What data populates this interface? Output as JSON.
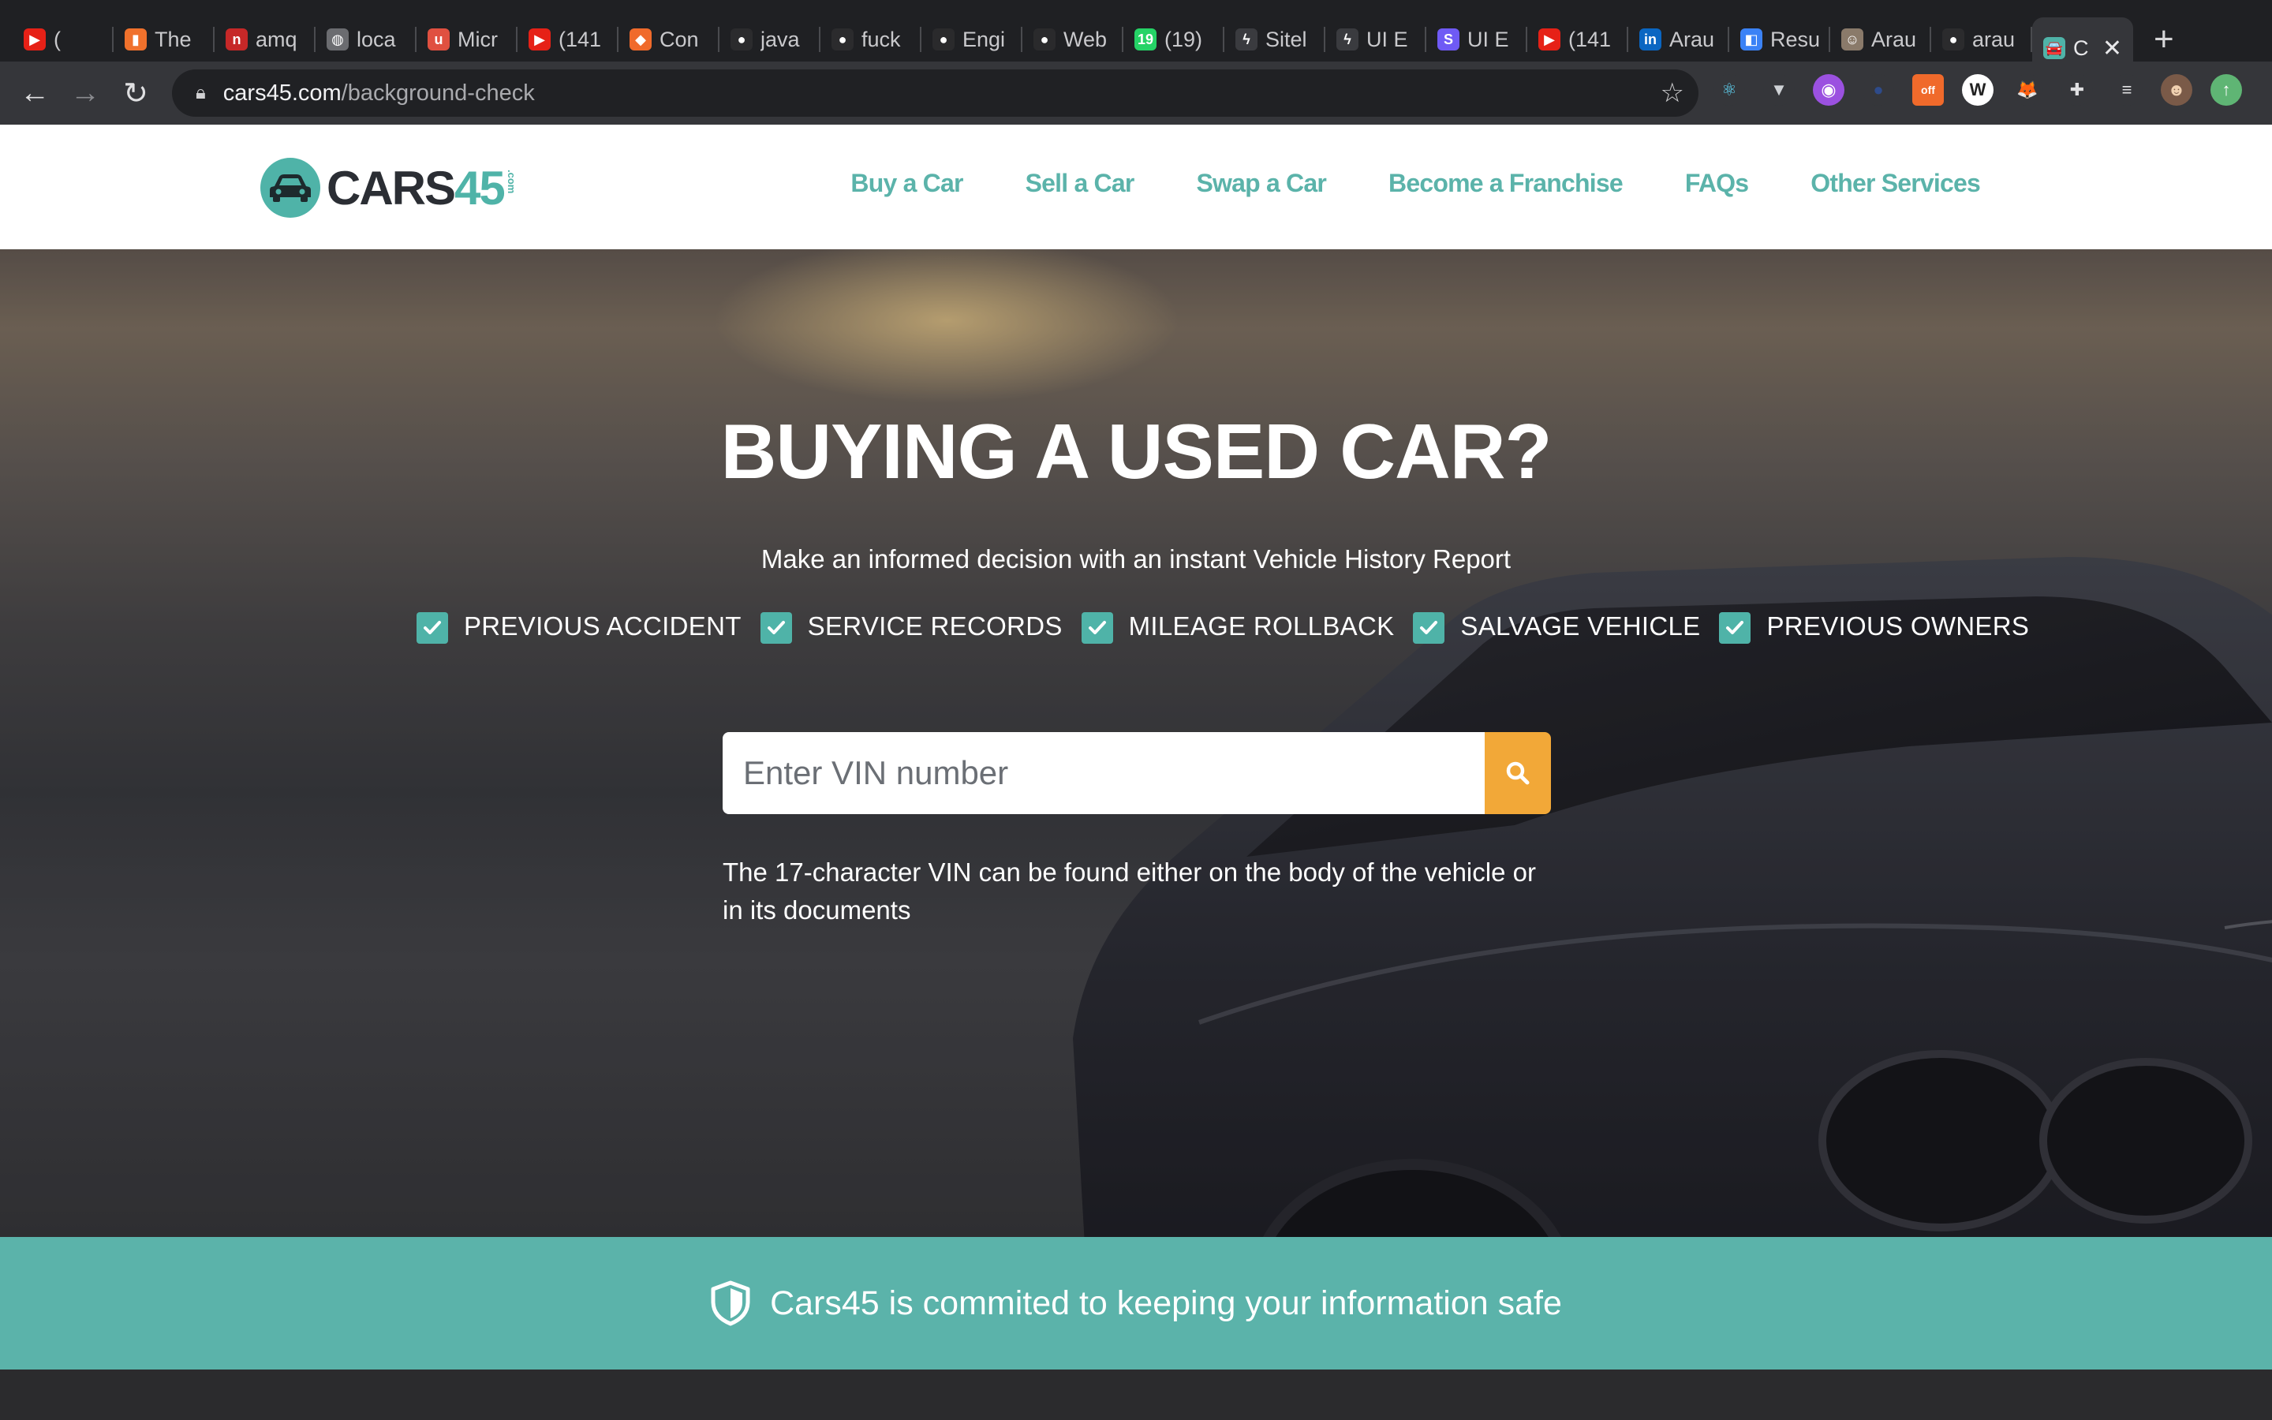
{
  "browser": {
    "tabs": [
      {
        "title": "(",
        "icon": "youtube-icon",
        "color": "#e62117",
        "glyph": "▶"
      },
      {
        "title": "The",
        "icon": "bucket-icon",
        "color": "#f0712c",
        "glyph": "▮"
      },
      {
        "title": "amq",
        "icon": "n-icon",
        "color": "#c62828",
        "glyph": "n"
      },
      {
        "title": "loca",
        "icon": "globe-icon",
        "color": "#6b6c70",
        "glyph": "◍"
      },
      {
        "title": "Micr",
        "icon": "u-icon",
        "color": "#e05040",
        "glyph": "u"
      },
      {
        "title": "(141",
        "icon": "youtube-icon",
        "color": "#e62117",
        "glyph": "▶"
      },
      {
        "title": "Con",
        "icon": "tag-icon",
        "color": "#f06a2b",
        "glyph": "◆"
      },
      {
        "title": "java",
        "icon": "github-icon",
        "color": "#2b2b2d",
        "glyph": "●"
      },
      {
        "title": "fuck",
        "icon": "github-icon",
        "color": "#2b2b2d",
        "glyph": "●"
      },
      {
        "title": "Engi",
        "icon": "dark-circle-icon",
        "color": "#2a2a2c",
        "glyph": "●"
      },
      {
        "title": "Web",
        "icon": "dark-circle-icon",
        "color": "#2a2a2c",
        "glyph": "●"
      },
      {
        "title": "(19)",
        "icon": "whatsapp-icon",
        "color": "#25d366",
        "glyph": "19"
      },
      {
        "title": "Sitel",
        "icon": "bolt-icon",
        "color": "#3a3b3f",
        "glyph": "ϟ"
      },
      {
        "title": "UI E",
        "icon": "bolt-icon",
        "color": "#3a3b3f",
        "glyph": "ϟ"
      },
      {
        "title": "UI E",
        "icon": "s-icon",
        "color": "#6f5af5",
        "glyph": "S"
      },
      {
        "title": "(141",
        "icon": "youtube-icon",
        "color": "#e62117",
        "glyph": "▶"
      },
      {
        "title": "Arau",
        "icon": "linkedin-icon",
        "color": "#0a66c2",
        "glyph": "in"
      },
      {
        "title": "Resu",
        "icon": "squares-icon",
        "color": "#3b82f6",
        "glyph": "◧"
      },
      {
        "title": "Arau",
        "icon": "portrait-icon",
        "color": "#8a7a6a",
        "glyph": "☺"
      },
      {
        "title": "arau",
        "icon": "github-icon",
        "color": "#2b2b2d",
        "glyph": "●"
      }
    ],
    "active_tab": {
      "title": "C",
      "icon": "cars45-favicon-icon",
      "color": "#4fb3a8",
      "glyph": "🚘",
      "close": "✕"
    },
    "new_tab": "+",
    "url_host": "cars45.com",
    "url_path": "/background-check",
    "extensions": [
      {
        "name": "react-devtools-icon",
        "color": "#35363a",
        "glyph": "⚛",
        "fg": "#61dafb"
      },
      {
        "name": "vue-devtools-icon",
        "color": "#35363a",
        "glyph": "▼",
        "fg": "#cfd2d6"
      },
      {
        "name": "purple-ext-icon",
        "color": "#9b51e0",
        "glyph": "◉",
        "fg": "#ffffff"
      },
      {
        "name": "blue-ext-icon",
        "color": "#35363a",
        "glyph": "●",
        "fg": "#2e4b8a"
      },
      {
        "name": "off-badge-ext-icon",
        "color": "#f06a2b",
        "glyph": "off",
        "fg": "#ffffff"
      },
      {
        "name": "w-ext-icon",
        "color": "#ffffff",
        "glyph": "W",
        "fg": "#222222"
      },
      {
        "name": "metamask-icon",
        "color": "#35363a",
        "glyph": "🦊",
        "fg": "#f6851b"
      },
      {
        "name": "puzzle-extensions-icon",
        "color": "#35363a",
        "glyph": "✚",
        "fg": "#e0e0e2"
      },
      {
        "name": "reading-list-icon",
        "color": "#35363a",
        "glyph": "≡",
        "fg": "#e0e0e2"
      },
      {
        "name": "profile-avatar-icon",
        "color": "#7a5a48",
        "glyph": "☻",
        "fg": "#f0d0b0"
      },
      {
        "name": "update-arrow-icon",
        "color": "#5fb574",
        "glyph": "↑",
        "fg": "#ffffff"
      }
    ]
  },
  "site": {
    "logo_word": "CARS",
    "logo_num": "45",
    "logo_com": ".com",
    "nav": [
      "Buy a Car",
      "Sell a Car",
      "Swap a Car",
      "Become a Franchise",
      "FAQs",
      "Other Services"
    ]
  },
  "hero": {
    "title": "BUYING A USED CAR?",
    "subtitle": "Make an informed decision with an instant Vehicle History Report",
    "checks": [
      "PREVIOUS ACCIDENT",
      "SERVICE RECORDS",
      "MILEAGE ROLLBACK",
      "SALVAGE VEHICLE",
      "PREVIOUS OWNERS"
    ],
    "vin_placeholder": "Enter VIN number",
    "vin_value": "",
    "hint": "The 17-character VIN can be found either on the body of the vehicle or in its documents"
  },
  "banner": {
    "text": "Cars45 is commited to keeping your information safe"
  },
  "colors": {
    "brand_teal": "#5bb3aa",
    "search_orange": "#f2a838",
    "browser_dark": "#1f2023"
  }
}
